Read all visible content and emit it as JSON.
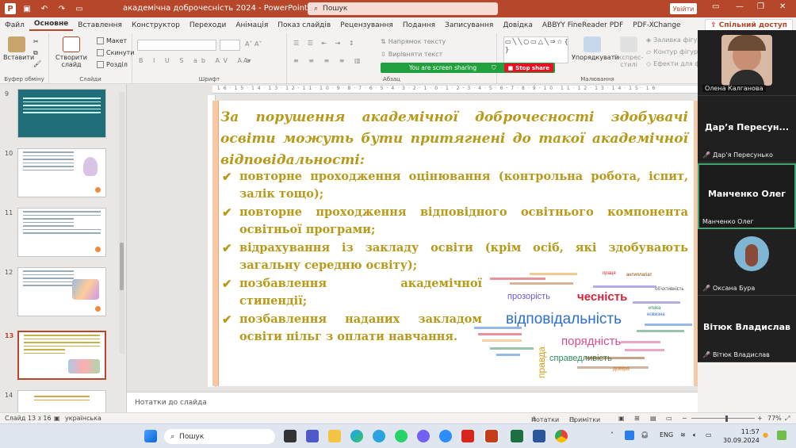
{
  "titlebar": {
    "doc_title": "академічна доброчесність 2024 - PowerPoint",
    "search_label": "Пошук",
    "signin_label": "Увійти"
  },
  "tabs": [
    "Файл",
    "Основне",
    "Вставлення",
    "Конструктор",
    "Переходи",
    "Анімація",
    "Показ слайдів",
    "Рецензування",
    "Подання",
    "Записування",
    "Довідка",
    "ABBYY FineReader PDF",
    "PDF-XChange"
  ],
  "share_label": "Спільний доступ",
  "ribbon": {
    "clipboard": {
      "paste": "Вставити",
      "group": "Буфер обміну"
    },
    "slides": {
      "new_slide": "Створити слайд",
      "layout": "Макет",
      "reset": "Скинути",
      "section": "Розділ",
      "group": "Слайди"
    },
    "font": {
      "group": "Шрифт"
    },
    "paragraph": {
      "text_direction": "Напрямок тексту",
      "align_text": "Вирівняти текст",
      "group": "Абзац"
    },
    "drawing": {
      "arrange": "Упорядкувати",
      "quick_styles": "Експрес-стилі",
      "fill": "Заливка фігури",
      "outline": "Контур фігури",
      "effects": "Ефекти для фігур",
      "group": "Малювання"
    }
  },
  "sharing": {
    "text": "You are screen sharing",
    "stop": "Stop share"
  },
  "thumbnails": [
    {
      "num": "9"
    },
    {
      "num": "10"
    },
    {
      "num": "11"
    },
    {
      "num": "12"
    },
    {
      "num": "13"
    },
    {
      "num": "14"
    }
  ],
  "slide": {
    "title": "За порушення академічної доброчесності здобувачі освіти можуть бути притягнені до такої академічної відповідальності:",
    "bullets": [
      "повторне проходження оцінювання (контрольна робота, іспит, залік тощо);",
      "повторне проходження відповідного освітнього компонента освітньої програми;",
      "відрахування із закладу освіти (крім осіб, які здобувають загальну середню освіту);",
      "позбавлення академічної стипендії;",
      "позбавлення наданих закладом освіти пільг з оплати навчання."
    ],
    "cloud_words": [
      {
        "t": "відповідальність",
        "c": "#2b6fd6"
      },
      {
        "t": "чесність",
        "c": "#d4243a"
      },
      {
        "t": "порядність",
        "c": "#d94c8c"
      },
      {
        "t": "справедливість",
        "c": "#2e8b57"
      },
      {
        "t": "прозорість",
        "c": "#6a5acd"
      },
      {
        "t": "правда",
        "c": "#d4a017"
      },
      {
        "t": "довіра",
        "c": "#e67e22"
      },
      {
        "t": "праця",
        "c": "#d4243a"
      },
      {
        "t": "антиплагіат",
        "c": "#8b4513"
      },
      {
        "t": "етика",
        "c": "#2e8b57"
      },
      {
        "t": "новизна",
        "c": "#2b6fd6"
      },
      {
        "t": "обʼєктивність",
        "c": "#555"
      }
    ]
  },
  "videos": [
    {
      "name": "Олена Калганова"
    },
    {
      "big": "Дар’я Пересун...",
      "name": "Дар’я Пересунько"
    },
    {
      "big": "Манченко Олег",
      "name": "Манченко Олег"
    },
    {
      "name": "Оксана Бура"
    },
    {
      "big": "Вітюк Владислав",
      "name": "Вітюк Владислав"
    }
  ],
  "notes_placeholder": "Нотатки до слайда",
  "status": {
    "slide": "Слайд 13 з 16",
    "lang": "українська",
    "notes": "Нотатки",
    "comments": "Примітки",
    "zoom": "77%"
  },
  "taskbar": {
    "search": "Пошук",
    "lang": "ENG",
    "time": "11:57",
    "date": "30.09.2024"
  }
}
